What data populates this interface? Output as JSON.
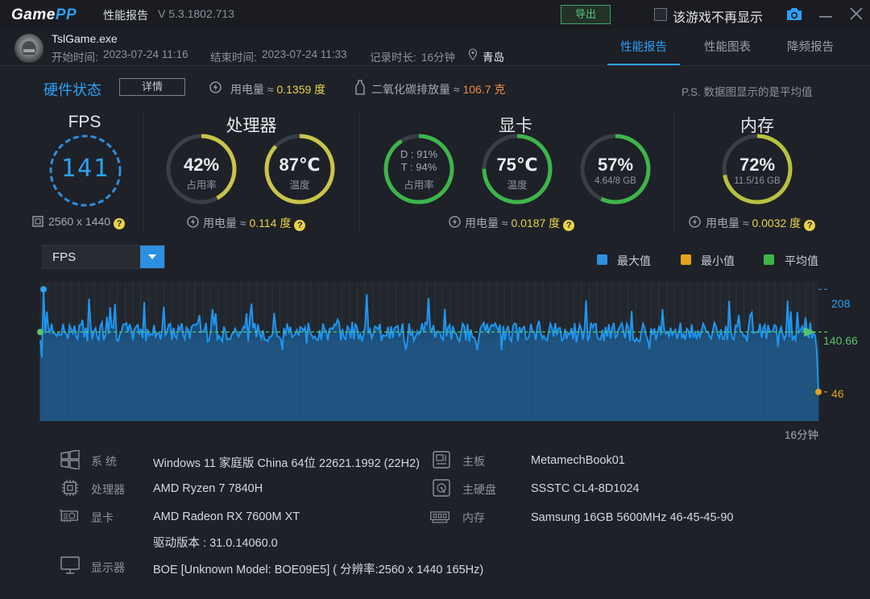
{
  "titlebar": {
    "logo_text_a": "Game",
    "logo_text_b": "PP",
    "title": "性能报告",
    "version": "V 5.3.1802.713",
    "export_label": "导出",
    "checkbox_label": "该游戏不再显示"
  },
  "game": {
    "name": "TslGame.exe",
    "start_label": "开始时间:",
    "start": "2023-07-24 11:16",
    "end_label": "结束时间:",
    "end": "2023-07-24 11:33",
    "duration_label": "记录时长:",
    "duration": "16分钟",
    "location": "青岛"
  },
  "tabs": [
    {
      "label": "性能报告",
      "active": true
    },
    {
      "label": "性能图表",
      "active": false
    },
    {
      "label": "降频报告",
      "active": false
    }
  ],
  "hardware": {
    "title": "硬件状态",
    "detail_label": "详情",
    "power_label": "用电量 ≈",
    "power_value": "0.1359 度",
    "co2_label": "二氧化碳排放量 ≈",
    "co2_value": "106.7 克",
    "note": "P.S. 数据图显示的是平均值"
  },
  "sections": {
    "fps": {
      "title": "FPS",
      "value": "141",
      "resolution": "2560 x 1440"
    },
    "cpu": {
      "title": "处理器",
      "usage": "42%",
      "usage_label": "占用率",
      "usage_frac": 0.42,
      "temp": "87℃",
      "temp_label": "温度",
      "temp_frac": 0.87,
      "power_label": "用电量 ≈",
      "power_value": "0.114 度"
    },
    "gpu": {
      "title": "显卡",
      "d_line": "D : 91%",
      "t_line": "T : 94%",
      "usage_label": "占用率",
      "usage_frac": 0.91,
      "temp": "75℃",
      "temp_label": "温度",
      "temp_frac": 0.75,
      "vram": "57%",
      "vram_sub": "4.64/8 GB",
      "vram_frac": 0.57,
      "power_label": "用电量 ≈",
      "power_value": "0.0187 度"
    },
    "memory": {
      "title": "内存",
      "usage": "72%",
      "usage_sub": "11.5/16 GB",
      "usage_frac": 0.72,
      "power_label": "用电量 ≈",
      "power_value": "0.0032 度"
    }
  },
  "metric_select": {
    "value": "FPS"
  },
  "legend": [
    {
      "label": "最大值",
      "color": "#2e8fe0"
    },
    {
      "label": "最小值",
      "color": "#e3a21a"
    },
    {
      "label": "平均值",
      "color": "#3db54a"
    }
  ],
  "chart_data": {
    "type": "area",
    "series_name": "FPS",
    "ylim": [
      0,
      220
    ],
    "max": 208,
    "avg": 140.66,
    "min": 46,
    "max_label": "208",
    "avg_label": "140.66",
    "min_label": "46",
    "xlabel_end": "16分钟",
    "x_range_min": [
      0,
      16
    ],
    "grid": true
  },
  "system_info": [
    {
      "icon": "windows-icon",
      "label": "系 统",
      "value": "Windows 11 家庭版 China 64位 22621.1992 (22H2)"
    },
    {
      "icon": "motherboard-icon",
      "label": "主板",
      "value": "MetamechBook01"
    },
    {
      "icon": "cpu-icon",
      "label": "处理器",
      "value": "AMD Ryzen 7 7840H"
    },
    {
      "icon": "disk-icon",
      "label": "主硬盘",
      "value": "SSSTC CL4-8D1024"
    },
    {
      "icon": "gpu-icon",
      "label": "显卡",
      "value": "AMD Radeon RX 7600M XT"
    },
    {
      "icon": "memory-icon",
      "label": "内存",
      "value": "Samsung 16GB 5600MHz 46-45-45-90"
    },
    {
      "icon": "driver",
      "label": "",
      "value": "驱动版本 : 31.0.14060.0"
    },
    {
      "icon": "monitor-icon",
      "label": "显示器",
      "value": "BOE [Unknown Model: BOE09E5] ( 分辨率:2560 x 1440 165Hz)"
    }
  ]
}
